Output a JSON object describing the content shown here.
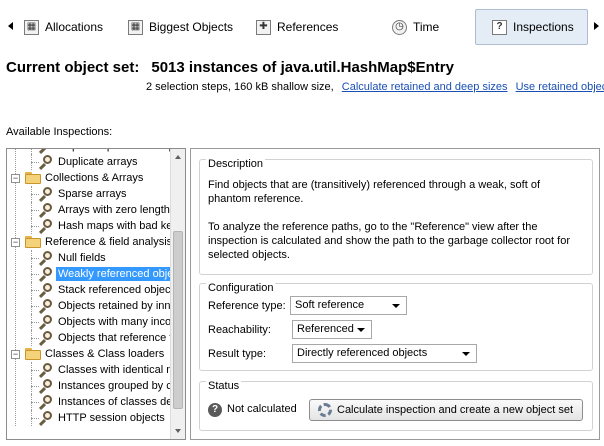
{
  "tabs": [
    {
      "label": "Allocations",
      "icon": "allocations-icon",
      "active": false
    },
    {
      "label": "Biggest Objects",
      "icon": "biggest-objects-icon",
      "active": false
    },
    {
      "label": "References",
      "icon": "references-icon",
      "active": false
    },
    {
      "label": "Time",
      "icon": "time-icon",
      "active": false
    },
    {
      "label": "Inspections",
      "icon": "inspections-icon",
      "active": true
    }
  ],
  "header": {
    "title": "Current object set:",
    "object_set": "5013 instances of java.util.HashMap$Entry",
    "summary": "2 selection steps, 160 kB shallow size,",
    "calc_link": "Calculate retained and deep sizes",
    "use_link": "Use retained objects"
  },
  "available_label": "Available Inspections:",
  "tree": [
    {
      "label": "Duplicate primitive wrappers",
      "type": "item"
    },
    {
      "label": "Duplicate arrays",
      "type": "item"
    },
    {
      "label": "Collections & Arrays",
      "type": "folder"
    },
    {
      "label": "Sparse arrays",
      "type": "item"
    },
    {
      "label": "Arrays with zero length",
      "type": "item"
    },
    {
      "label": "Hash maps with bad keys",
      "type": "item"
    },
    {
      "label": "Reference & field analysis",
      "type": "folder"
    },
    {
      "label": "Null fields",
      "type": "item"
    },
    {
      "label": "Weakly referenced objects",
      "type": "item",
      "selected": true
    },
    {
      "label": "Stack referenced objects",
      "type": "item"
    },
    {
      "label": "Objects retained by inner classes",
      "type": "item"
    },
    {
      "label": "Objects with many incoming references",
      "type": "item"
    },
    {
      "label": "Objects that reference themselves",
      "type": "item"
    },
    {
      "label": "Classes & Class loaders",
      "type": "folder"
    },
    {
      "label": "Classes with identical names",
      "type": "item"
    },
    {
      "label": "Instances grouped by class loader",
      "type": "item"
    },
    {
      "label": "Instances of classes defined in other loaders",
      "type": "item"
    },
    {
      "label": "HTTP session objects",
      "type": "item"
    }
  ],
  "description": {
    "title": "Description",
    "lines": [
      "Find objects that are (transitively) referenced through a weak, soft of",
      "phantom reference.",
      "",
      "To analyze the reference paths, go to the \"Reference\" view after the",
      "inspection is calculated and show the path to the garbage collector root for",
      "selected objects."
    ]
  },
  "configuration": {
    "title": "Configuration",
    "reference_type_label": "Reference type:",
    "reference_type_value": "Soft reference",
    "reachability_label": "Reachability:",
    "reachability_value": "Referenced",
    "result_type_label": "Result type:",
    "result_type_value": "Directly referenced objects"
  },
  "status": {
    "title": "Status",
    "value": "Not calculated",
    "button": "Calculate inspection and create a new object set"
  }
}
